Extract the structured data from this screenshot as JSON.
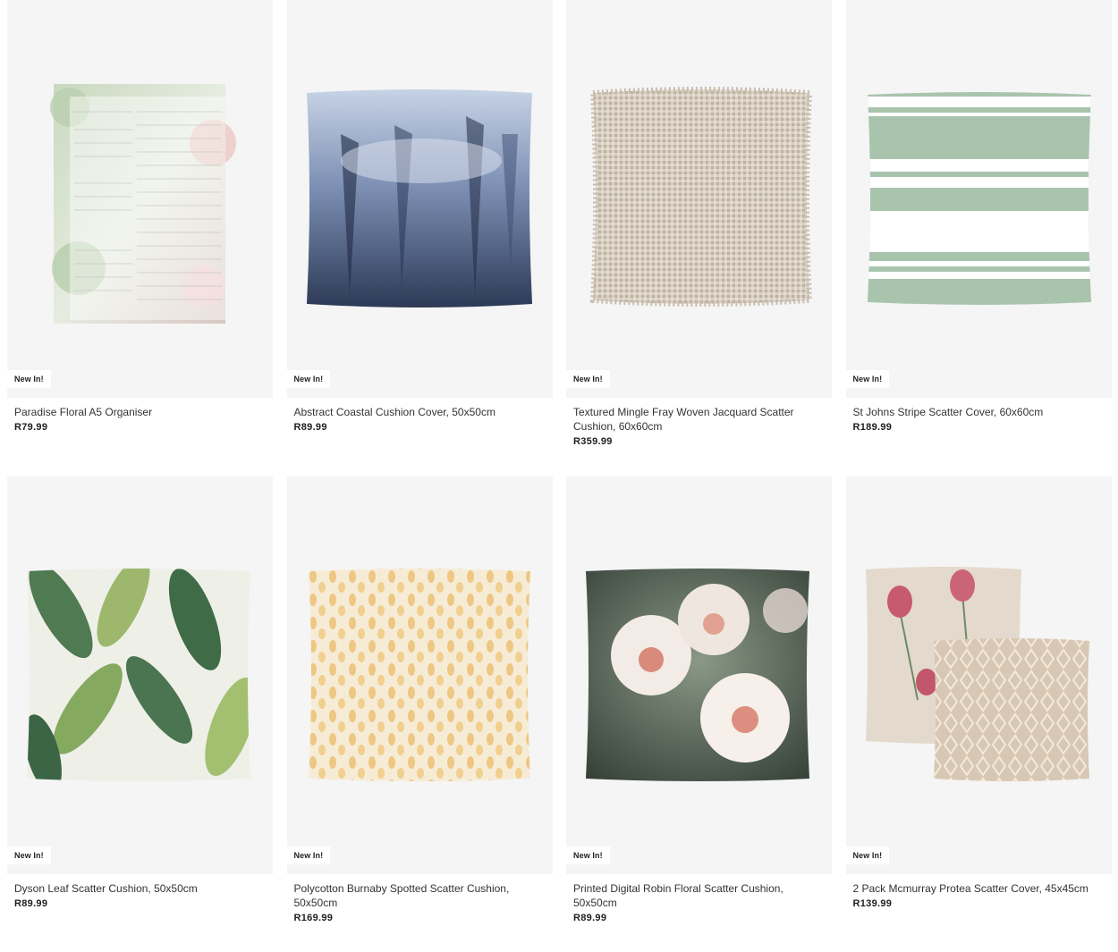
{
  "badge_label": "New In!",
  "products": [
    {
      "name": "Paradise Floral A5 Organiser",
      "price": "R79.99",
      "icon": "organiser-image"
    },
    {
      "name": "Abstract Coastal Cushion Cover, 50x50cm",
      "price": "R89.99",
      "icon": "cushion-image"
    },
    {
      "name": "Textured Mingle Fray Woven Jacquard Scatter Cushion, 60x60cm",
      "price": "R359.99",
      "icon": "cushion-image"
    },
    {
      "name": "St Johns Stripe Scatter Cover, 60x60cm",
      "price": "R189.99",
      "icon": "cushion-image"
    },
    {
      "name": "Dyson Leaf Scatter Cushion, 50x50cm",
      "price": "R89.99",
      "icon": "cushion-image"
    },
    {
      "name": "Polycotton Burnaby Spotted Scatter Cushion, 50x50cm",
      "price": "R169.99",
      "icon": "cushion-image"
    },
    {
      "name": "Printed Digital Robin Floral Scatter Cushion, 50x50cm",
      "price": "R89.99",
      "icon": "cushion-image"
    },
    {
      "name": "2 Pack Mcmurray Protea Scatter Cover, 45x45cm",
      "price": "R139.99",
      "icon": "cushion-image"
    }
  ],
  "colors": {
    "card_background": "#f5f5f5",
    "badge_background": "#ffffff",
    "price_text": "#1e1e1e"
  }
}
